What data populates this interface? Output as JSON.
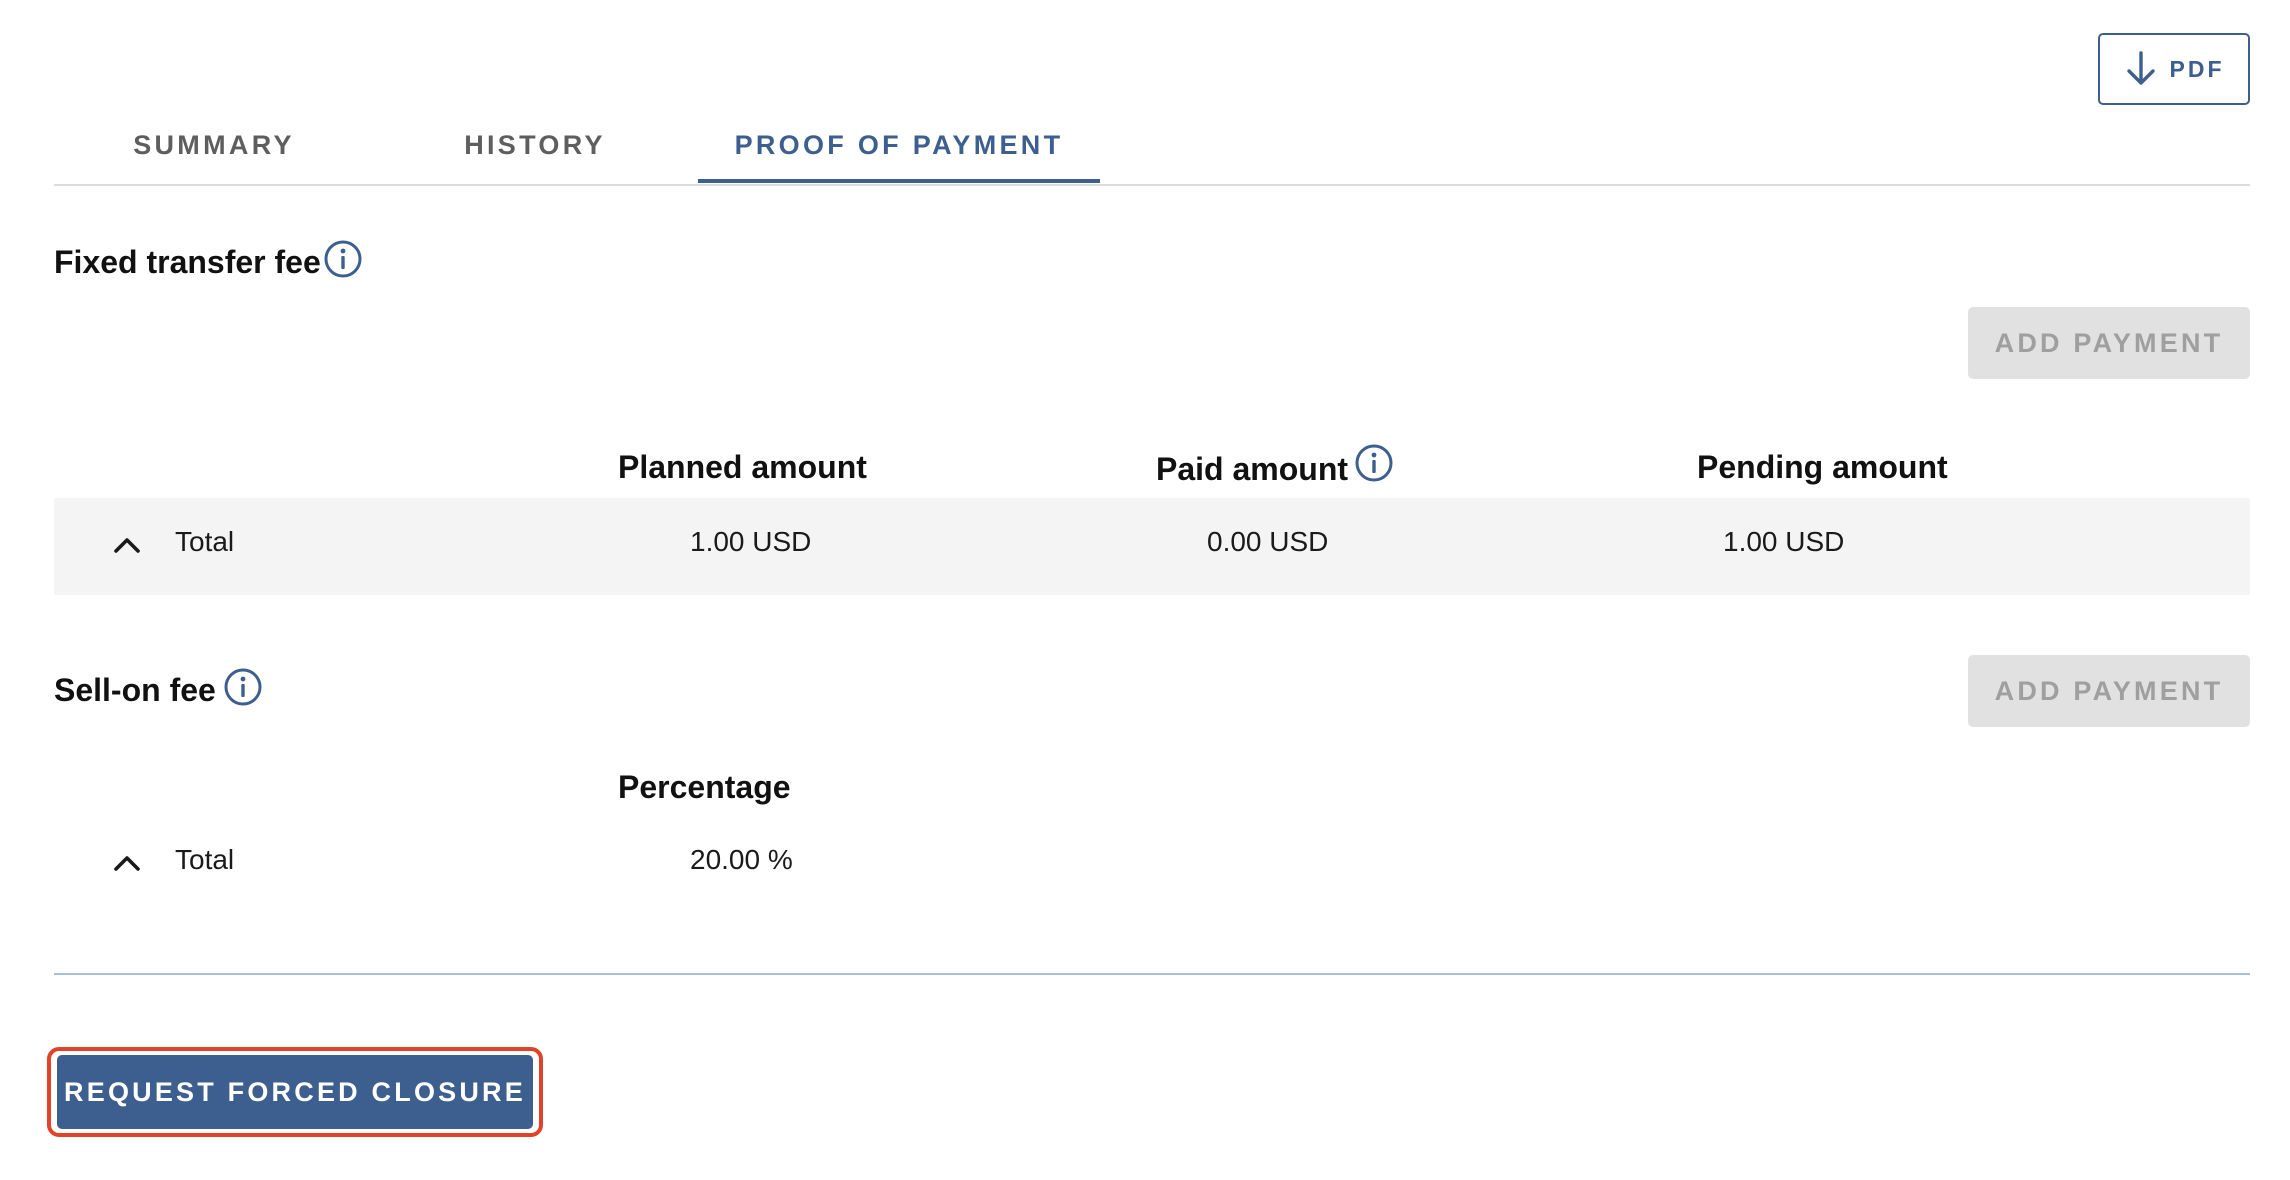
{
  "toolbar": {
    "pdf_label": "PDF",
    "pdf_icon": "download-arrow-icon"
  },
  "tabs": [
    {
      "label": "SUMMARY",
      "active": false
    },
    {
      "label": "HISTORY",
      "active": false
    },
    {
      "label": "PROOF OF PAYMENT",
      "active": true
    }
  ],
  "fixed_fee": {
    "title": "Fixed transfer fee",
    "info_icon": "info-icon",
    "add_payment_label": "ADD PAYMENT",
    "add_payment_disabled": true,
    "columns": {
      "planned": "Planned amount",
      "paid": "Paid amount",
      "pending": "Pending amount"
    },
    "total_row": {
      "label": "Total",
      "planned": "1.00 USD",
      "paid": "0.00 USD",
      "pending": "1.00 USD",
      "expanded": true
    }
  },
  "sell_on_fee": {
    "title": "Sell-on fee",
    "info_icon": "info-icon",
    "add_payment_label": "ADD PAYMENT",
    "add_payment_disabled": true,
    "columns": {
      "percentage": "Percentage"
    },
    "total_row": {
      "label": "Total",
      "percentage": "20.00 %",
      "expanded": true
    }
  },
  "footer": {
    "request_forced_closure_label": "REQUEST FORCED CLOSURE"
  },
  "colors": {
    "accent": "#3d5f8f",
    "disabled_bg": "#e1e1e1",
    "disabled_text": "#9f9f9f",
    "row_bg": "#f4f4f4",
    "highlight": "#e0432a"
  }
}
